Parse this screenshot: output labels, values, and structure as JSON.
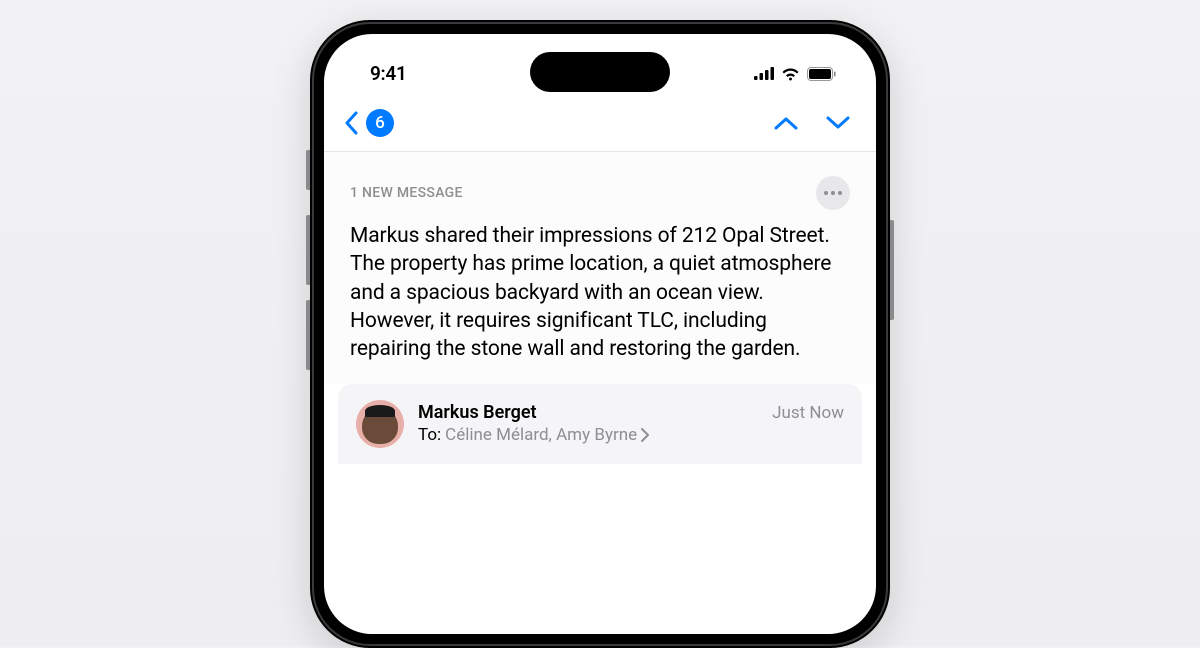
{
  "status": {
    "time": "9:41"
  },
  "nav": {
    "badge": "6"
  },
  "message": {
    "header_label": "1 NEW MESSAGE",
    "summary": "Markus shared their impressions of 212 Opal Street. The property has prime location, a quiet atmosphere and a spacious backyard with an ocean view. However, it requires significant TLC, including repairing the stone wall and restoring the garden."
  },
  "sender_card": {
    "name": "Markus Berget",
    "timestamp": "Just Now",
    "to_label": "To:",
    "recipients": "Céline Mélard, Amy Byrne"
  }
}
